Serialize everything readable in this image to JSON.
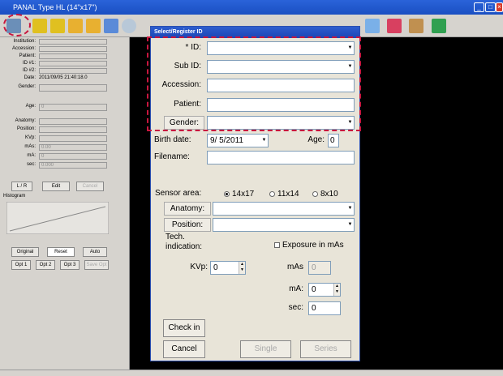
{
  "window": {
    "title": "PANAL Type HL (14\"x17\")"
  },
  "left": {
    "labels": [
      "Institution:",
      "Accession:",
      "Patient:",
      "ID #1:",
      "ID #2:",
      "Date:",
      "Gender:",
      "Age:",
      "Anatomy:",
      "Position:",
      "KVp:",
      "mAs:",
      "mA:",
      "sec:"
    ],
    "date_value": "2011/09/05 21:40:18.0",
    "age_value": "0",
    "mAs_value": "0.00",
    "mA_value": "0",
    "sec_value": "0.000",
    "btn_lr": "L / R",
    "btn_edit": "Edit",
    "btn_cancel": "Cancel",
    "histogram_label": "Histogram",
    "btn_original": "Original",
    "btn_reset": "Reset",
    "btn_auto": "Auto",
    "btn_opt1": "Opt 1",
    "btn_opt2": "Opt 2",
    "btn_opt3": "Opt 3",
    "btn_saveopt": "Save Opt"
  },
  "dialog": {
    "title": "Select/Register ID",
    "id_label": "* ID:",
    "subid_label": "Sub ID:",
    "accession_label": "Accession:",
    "patient_label": "Patient:",
    "gender_label": "Gender:",
    "birth_label": "Birth date:",
    "birth_value": "9/  5/2011",
    "age_label": "Age:",
    "age_value": "0",
    "filename_label": "Filename:",
    "sensor_label": "Sensor area:",
    "sensor_options": [
      "14x17",
      "11x14",
      "8x10"
    ],
    "anatomy_label": "Anatomy:",
    "position_label": "Position:",
    "tech_label": "Tech.\nindication:",
    "exposure_label": "Exposure in mAs",
    "kvp_label": "KVp:",
    "kvp_value": "0",
    "mas_label": "mAs",
    "mas_value": "0",
    "ma_label": "mA:",
    "ma_value": "0",
    "sec_label": "sec:",
    "sec_value": "0",
    "btn_checkin": "Check in",
    "btn_cancel": "Cancel",
    "btn_single": "Single",
    "btn_series": "Series"
  },
  "colors": {
    "highlight": "#c8163e",
    "titlebar": "#2a63d9"
  }
}
